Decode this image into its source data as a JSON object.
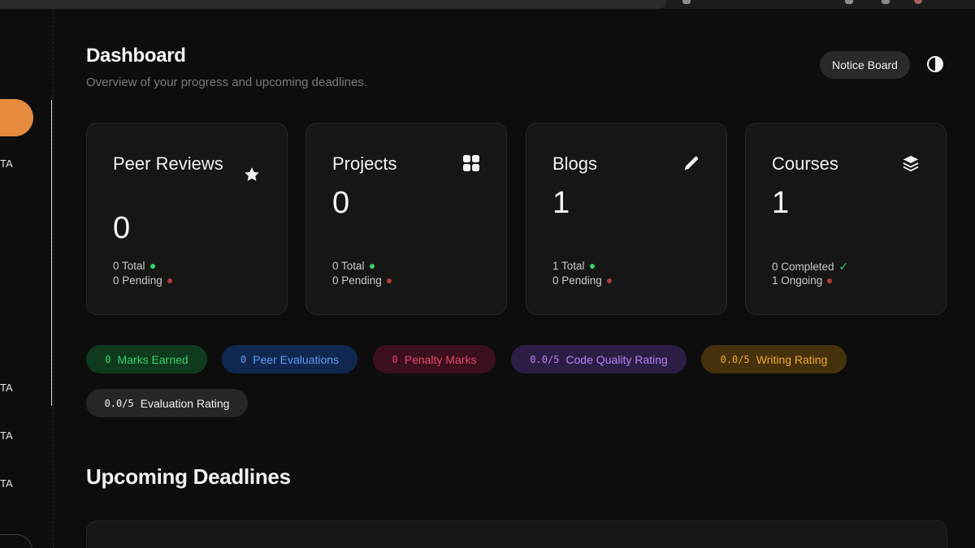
{
  "header": {
    "title": "Dashboard",
    "subtitle": "Overview of your progress and upcoming deadlines.",
    "notice_label": "Notice Board",
    "theme_icon": "contrast-icon"
  },
  "sidebar": {
    "labels": [
      "TA",
      "TA",
      "TA",
      "TA"
    ]
  },
  "cards": [
    {
      "title": "Peer Reviews",
      "icon": "star-icon",
      "value": "0",
      "line1": "0 Total",
      "line2": "0 Pending"
    },
    {
      "title": "Projects",
      "icon": "grid-icon",
      "value": "0",
      "line1": "0 Total",
      "line2": "0 Pending"
    },
    {
      "title": "Blogs",
      "icon": "pencil-icon",
      "value": "1",
      "line1": "1 Total",
      "line2": "0 Pending"
    },
    {
      "title": "Courses",
      "icon": "layers-icon",
      "value": "1",
      "line1": "0 Completed",
      "line2": "1 Ongoing"
    }
  ],
  "badges": [
    {
      "num": "0",
      "label": "Marks Earned",
      "color": "#37d36d"
    },
    {
      "num": "0",
      "label": "Peer Evaluations",
      "color": "#5f98f2"
    },
    {
      "num": "0",
      "label": "Penalty Marks",
      "color": "#e0476b"
    },
    {
      "num": "0.0/5",
      "label": "Code Quality Rating",
      "color": "#b083f0"
    },
    {
      "num": "0.0/5",
      "label": "Writing Rating",
      "color": "#efa631"
    },
    {
      "num": "0.0/5",
      "label": "Evaluation Rating",
      "color": "#f0f0f0"
    }
  ],
  "deadlines": {
    "title": "Upcoming Deadlines"
  },
  "colors": {
    "accent": "#e58a3f",
    "background": "#0d0d0d",
    "card": "#161616"
  }
}
